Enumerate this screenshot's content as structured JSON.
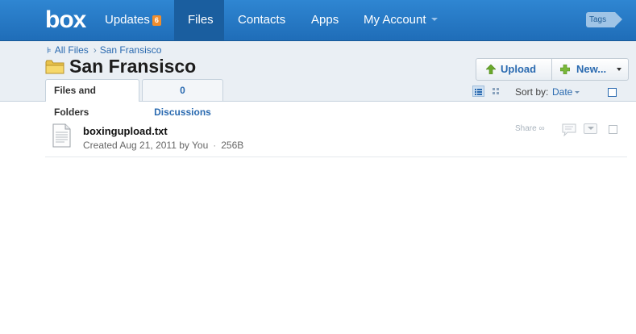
{
  "nav": {
    "logo": "box",
    "updates_label": "Updates",
    "updates_count": "6",
    "files_label": "Files",
    "contacts_label": "Contacts",
    "apps_label": "Apps",
    "account_label": "My Account",
    "tags_label": "Tags"
  },
  "breadcrumb": {
    "all_files": "All Files",
    "current": "San Fransisco"
  },
  "folder": {
    "title": "San Fransisco"
  },
  "tabs": [
    {
      "label": "Files and Folders",
      "active": true
    },
    {
      "label": "0 Discussions",
      "active": false
    }
  ],
  "actions": {
    "upload_label": "Upload",
    "new_label": "New..."
  },
  "sort": {
    "label": "Sort by:",
    "value": "Date"
  },
  "files": [
    {
      "name": "boxingupload.txt",
      "created": "Created Aug 21, 2011 by You",
      "size": "256B",
      "share_label": "Share"
    }
  ],
  "colors": {
    "nav_bar": "#2f86d2",
    "nav_active": "#1a5e9f",
    "link": "#2a6ab0",
    "badge": "#f08d2c",
    "upload_arrow": "#6aa82c"
  },
  "icons": [
    "folder-icon",
    "upload-arrow-icon",
    "plus-icon",
    "list-view-icon",
    "grid-view-icon",
    "document-icon",
    "comment-icon",
    "menu-dropdown-icon",
    "link-icon"
  ]
}
